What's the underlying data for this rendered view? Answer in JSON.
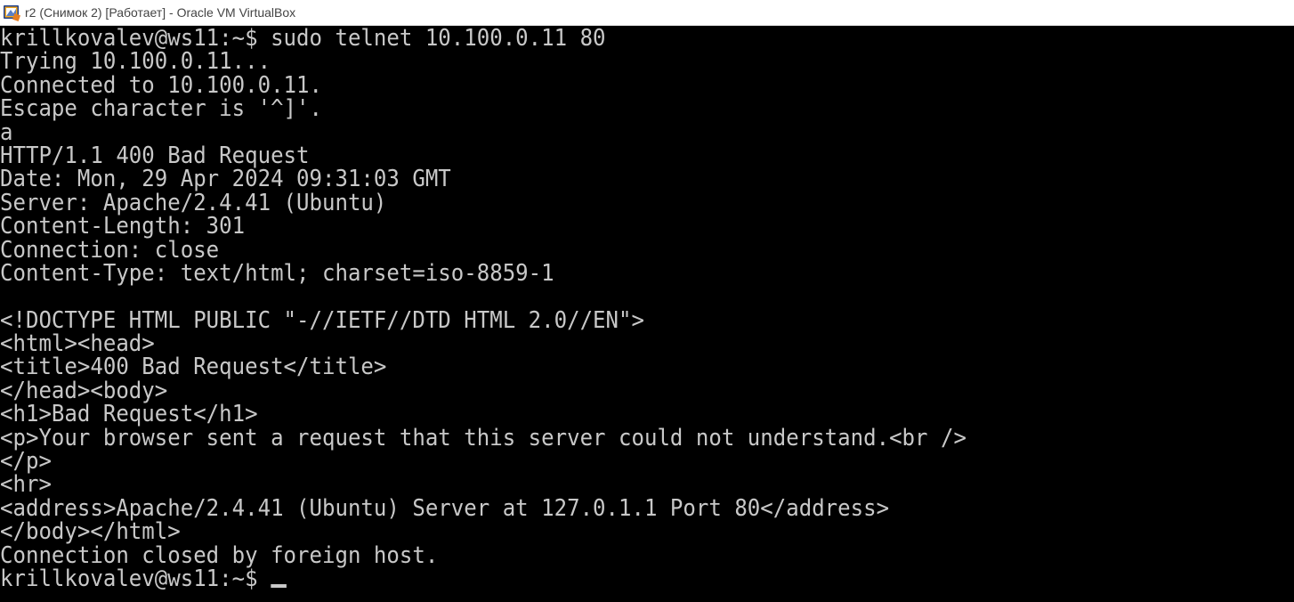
{
  "window": {
    "title": "r2 (Снимок 2) [Работает] - Oracle VM VirtualBox",
    "icon": "virtualbox-icon"
  },
  "console": {
    "lines": [
      "krillkovalev@ws11:~$ sudo telnet 10.100.0.11 80",
      "Trying 10.100.0.11...",
      "Connected to 10.100.0.11.",
      "Escape character is '^]'.",
      "a",
      "HTTP/1.1 400 Bad Request",
      "Date: Mon, 29 Apr 2024 09:31:03 GMT",
      "Server: Apache/2.4.41 (Ubuntu)",
      "Content-Length: 301",
      "Connection: close",
      "Content-Type: text/html; charset=iso-8859-1",
      "",
      "<!DOCTYPE HTML PUBLIC \"-//IETF//DTD HTML 2.0//EN\">",
      "<html><head>",
      "<title>400 Bad Request</title>",
      "</head><body>",
      "<h1>Bad Request</h1>",
      "<p>Your browser sent a request that this server could not understand.<br />",
      "</p>",
      "<hr>",
      "<address>Apache/2.4.41 (Ubuntu) Server at 127.0.1.1 Port 80</address>",
      "</body></html>",
      "Connection closed by foreign host."
    ],
    "prompt": "krillkovalev@ws11:~$ "
  },
  "colors": {
    "console_bg": "#000000",
    "console_fg": "#c8c8c8",
    "titlebar_bg": "#ffffff"
  }
}
